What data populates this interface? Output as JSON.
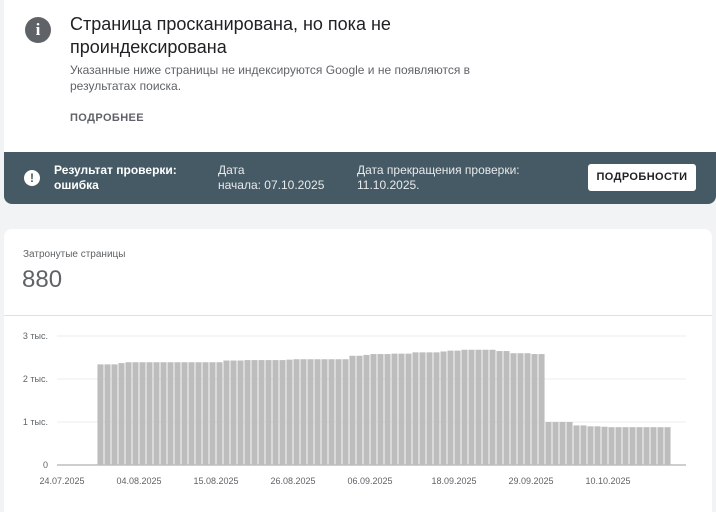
{
  "top": {
    "title": "Страница просканирована, но пока не проиндексирована",
    "description": "Указанные ниже страницы не индексируются Google и не появляются в результатах поиска.",
    "more_label": "ПОДРОБНЕЕ"
  },
  "status": {
    "result_label": "Результат проверки:",
    "result_value": "ошибка",
    "start_label": "Дата",
    "start_value": "начала: 07.10.2025",
    "end_label": "Дата прекращения проверки:",
    "end_value": "11.10.2025.",
    "details_label": "ПОДРОБНОСТИ"
  },
  "metric": {
    "label": "Затронутые страницы",
    "value": "880"
  },
  "colors": {
    "status_bar": "#455a64",
    "bar": "#bdbdbd"
  },
  "chart_data": {
    "type": "bar",
    "y_ticks": [
      {
        "value": 0,
        "label": "0"
      },
      {
        "value": 1000,
        "label": "1 тыс."
      },
      {
        "value": 2000,
        "label": "2 тыс."
      },
      {
        "value": 3000,
        "label": "3 тыс."
      }
    ],
    "ylim": [
      0,
      3000
    ],
    "x_ticks": [
      {
        "index": 0,
        "label": "24.07.2025"
      },
      {
        "index": 11,
        "label": "04.08.2025"
      },
      {
        "index": 22,
        "label": "15.08.2025"
      },
      {
        "index": 33,
        "label": "26.08.2025"
      },
      {
        "index": 44,
        "label": "06.09.2025"
      },
      {
        "index": 56,
        "label": "18.09.2025"
      },
      {
        "index": 67,
        "label": "29.09.2025"
      },
      {
        "index": 78,
        "label": "10.10.2025"
      }
    ],
    "start_date": "24.07.2025",
    "values": [
      null,
      null,
      null,
      null,
      null,
      2340,
      2340,
      2340,
      2370,
      2390,
      2390,
      2390,
      2390,
      2390,
      2390,
      2390,
      2390,
      2390,
      2390,
      2390,
      2390,
      2390,
      2390,
      2430,
      2430,
      2430,
      2440,
      2440,
      2440,
      2440,
      2440,
      2440,
      2450,
      2460,
      2460,
      2460,
      2460,
      2460,
      2460,
      2460,
      2460,
      2540,
      2540,
      2560,
      2580,
      2580,
      2580,
      2590,
      2590,
      2590,
      2620,
      2620,
      2620,
      2620,
      2640,
      2660,
      2660,
      2680,
      2680,
      2680,
      2680,
      2680,
      2650,
      2650,
      2600,
      2600,
      2600,
      2580,
      2580,
      1000,
      1000,
      1000,
      1000,
      920,
      920,
      900,
      900,
      890,
      880,
      880,
      880,
      880,
      880,
      880,
      880,
      880,
      880
    ]
  }
}
